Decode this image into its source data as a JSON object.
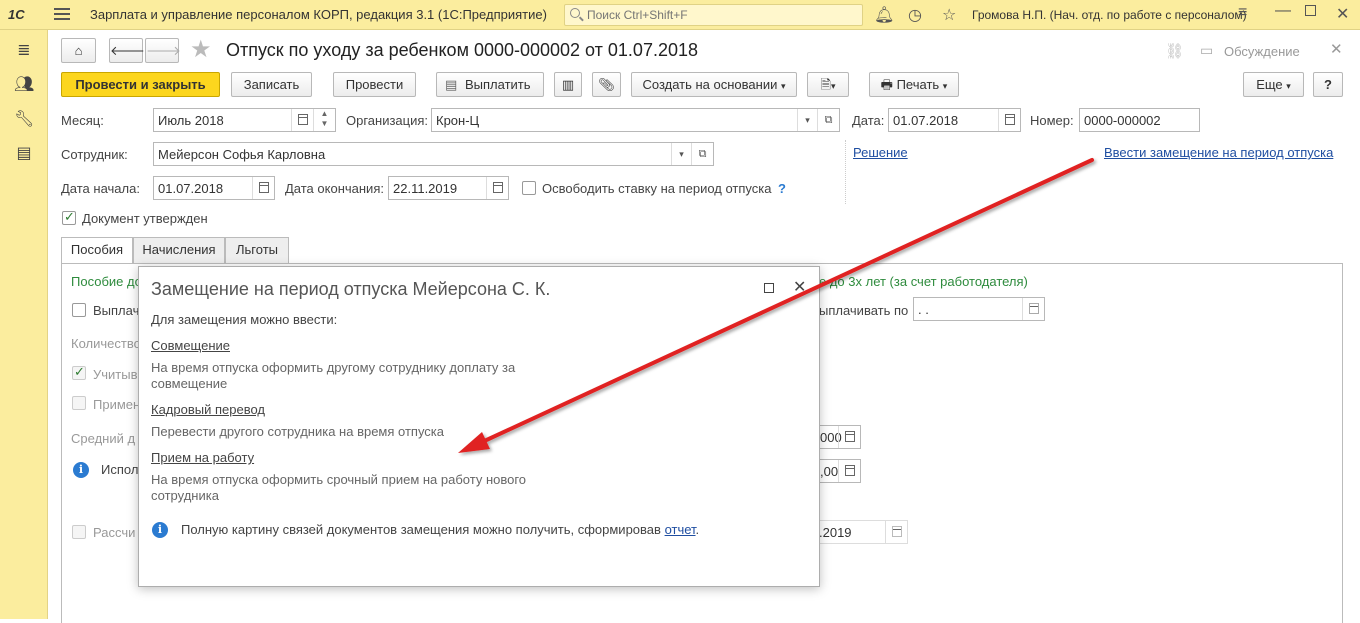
{
  "app": {
    "logo": "1С",
    "title": "Зарплата и управление персоналом КОРП, редакция 3.1  (1С:Предприятие)",
    "search_placeholder": "Поиск Ctrl+Shift+F",
    "user": "Громова Н.П. (Нач. отд. по работе с персоналом)"
  },
  "document": {
    "title": "Отпуск по уходу за ребенком 0000-000002 от 01.07.2018",
    "discussion": "Обсуждение"
  },
  "toolbar": {
    "post_close": "Провести и закрыть",
    "save": "Записать",
    "post": "Провести",
    "pay": "Выплатить",
    "create_based": "Создать на основании",
    "print": "Печать",
    "more": "Еще",
    "help": "?"
  },
  "form": {
    "month_label": "Месяц:",
    "month_value": "Июль 2018",
    "org_label": "Организация:",
    "org_value": "Крон-Ц",
    "date_label": "Дата:",
    "date_value": "01.07.2018",
    "number_label": "Номер:",
    "number_value": "0000-000002",
    "employee_label": "Сотрудник:",
    "employee_value": "Мейерсон Софья Карловна",
    "decision_link": "Решение",
    "replacement_link": "Ввести замещение на период отпуска",
    "start_label": "Дата начала:",
    "start_value": "01.07.2018",
    "end_label": "Дата окончания:",
    "end_value": "22.11.2019",
    "free_rate_label": "Освободить ставку на период отпуска",
    "free_rate_help": "?",
    "approved_label": "Документ утвержден"
  },
  "tabs": [
    "Пособия",
    "Начисления",
    "Льготы"
  ],
  "tab_content": {
    "allowance_title": "Пособие до",
    "allowance_right": "е до 3х лет (за счет работодателя)",
    "pay_label": "Выплач",
    "pay_until_label": "ыплачивать по",
    "pay_until_value": " .  .",
    "quantity_label": "Количество",
    "consider_label": "Учитыв",
    "apply_label": "Примен",
    "avg_label": "Средний д",
    "use_label": "Исполь",
    "val1": "000",
    "val2": ",00",
    "recalc_label": "Рассчи",
    "recalc_date": ".2019"
  },
  "modal": {
    "title": "Замещение на период отпуска Мейерсона С. К.",
    "intro": "Для замещения можно ввести:",
    "options": [
      {
        "link": "Совмещение",
        "desc": "На время отпуска оформить другому сотруднику доплату за совмещение"
      },
      {
        "link": "Кадровый перевод",
        "desc": "Перевести другого сотрудника на время отпуска"
      },
      {
        "link": "Прием на работу",
        "desc": "На время отпуска оформить срочный прием на работу нового сотрудника"
      }
    ],
    "footer_text": "Полную картину связей документов замещения можно получить, сформировав",
    "footer_link": "отчет",
    "footer_dot": "."
  },
  "colors": {
    "accent_yellow": "#fcd61e",
    "panel_yellow": "#fbed9e",
    "link_blue": "#1f4ea1",
    "arrow_red": "#e02020",
    "green_text": "#2e8b3d"
  }
}
